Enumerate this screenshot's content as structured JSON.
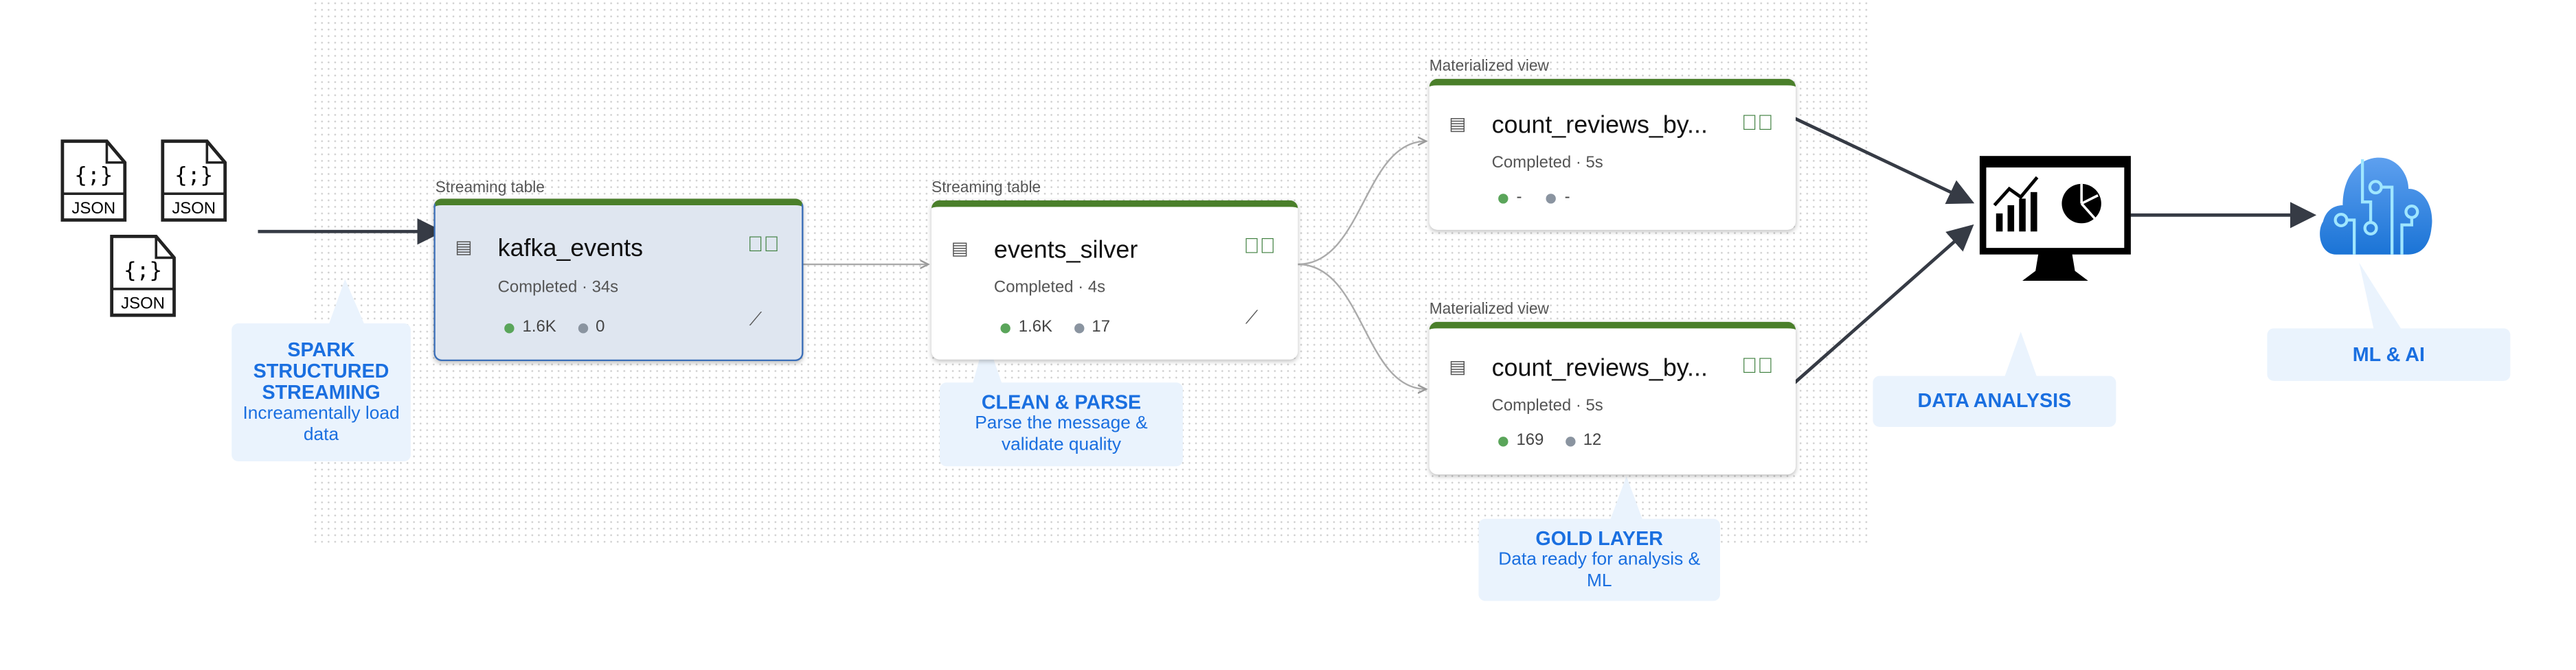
{
  "sources": {
    "file_label": "JSON",
    "count": 3
  },
  "nodes": [
    {
      "type_label": "Streaming table",
      "name": "kafka_events",
      "status": "Completed · 34s",
      "metric_green": "1.6K",
      "metric_gray": "0",
      "selected": true
    },
    {
      "type_label": "Streaming table",
      "name": "events_silver",
      "status": "Completed · 4s",
      "metric_green": "1.6K",
      "metric_gray": "17"
    },
    {
      "type_label": "Materialized view",
      "name": "count_reviews_by...",
      "status": "Completed · 5s",
      "metric_green": "-",
      "metric_gray": "-"
    },
    {
      "type_label": "Materialized view",
      "name": "count_reviews_by...",
      "status": "Completed · 5s",
      "metric_green": "169",
      "metric_gray": "12"
    }
  ],
  "callouts": {
    "spark": {
      "title": "SPARK STRUCTURED STREAMING",
      "text": "Increamentally load data"
    },
    "clean": {
      "title": "CLEAN & PARSE",
      "text": "Parse the message & validate quality"
    },
    "gold": {
      "title": "GOLD LAYER",
      "text": "Data ready for analysis & ML"
    },
    "analysis": {
      "title": "DATA ANALYSIS"
    },
    "mlai": {
      "title": "ML & AI"
    }
  },
  "colors": {
    "callout_bg": "#eaf3fd",
    "callout_text": "#1a6fe0",
    "success_bar": "#4a7f2a",
    "selected_border": "#3b6fb8",
    "green_dot": "#5aa55a",
    "gray_dot": "#8a94a0"
  }
}
